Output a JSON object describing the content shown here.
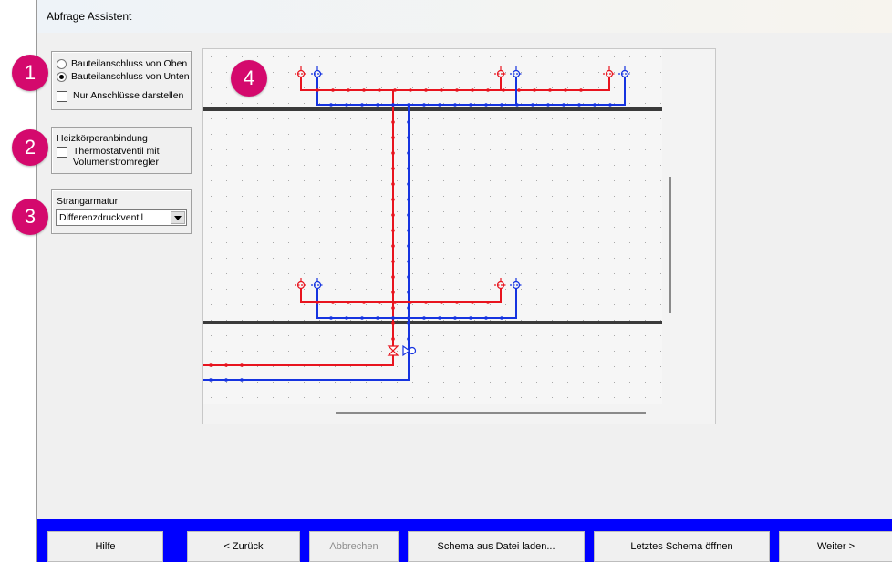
{
  "window": {
    "title": "Abfrage Assistent"
  },
  "connection_group": {
    "options": [
      {
        "label": "Bauteilanschluss von Oben",
        "selected": false
      },
      {
        "label": "Bauteilanschluss von Unten",
        "selected": true
      }
    ],
    "show_connections_only": {
      "label": "Nur Anschlüsse darstellen",
      "checked": false
    }
  },
  "radiator_group": {
    "title": "Heizkörperanbindung",
    "thermostat_valve": {
      "label_line1": "Thermostatventil  mit",
      "label_line2": "Volumenstromregler",
      "checked": false
    }
  },
  "riser_group": {
    "title": "Strangarmatur",
    "selected": "Differenzdruckventil"
  },
  "badges": [
    "1",
    "2",
    "3",
    "4"
  ],
  "schematic": {
    "colors": {
      "supply": "#e8141e",
      "return": "#1533e0",
      "floor": "#3a3a3a",
      "grid_dot": "#a8a8a8"
    }
  },
  "buttons": {
    "help": "Hilfe",
    "back": "< Zurück",
    "cancel": "Abbrechen",
    "load_schema": "Schema aus Datei laden...",
    "open_last": "Letztes Schema öffnen",
    "next": "Weiter >"
  },
  "colors": {
    "accent_bar": "#0000ff",
    "badge": "#d4096d"
  }
}
